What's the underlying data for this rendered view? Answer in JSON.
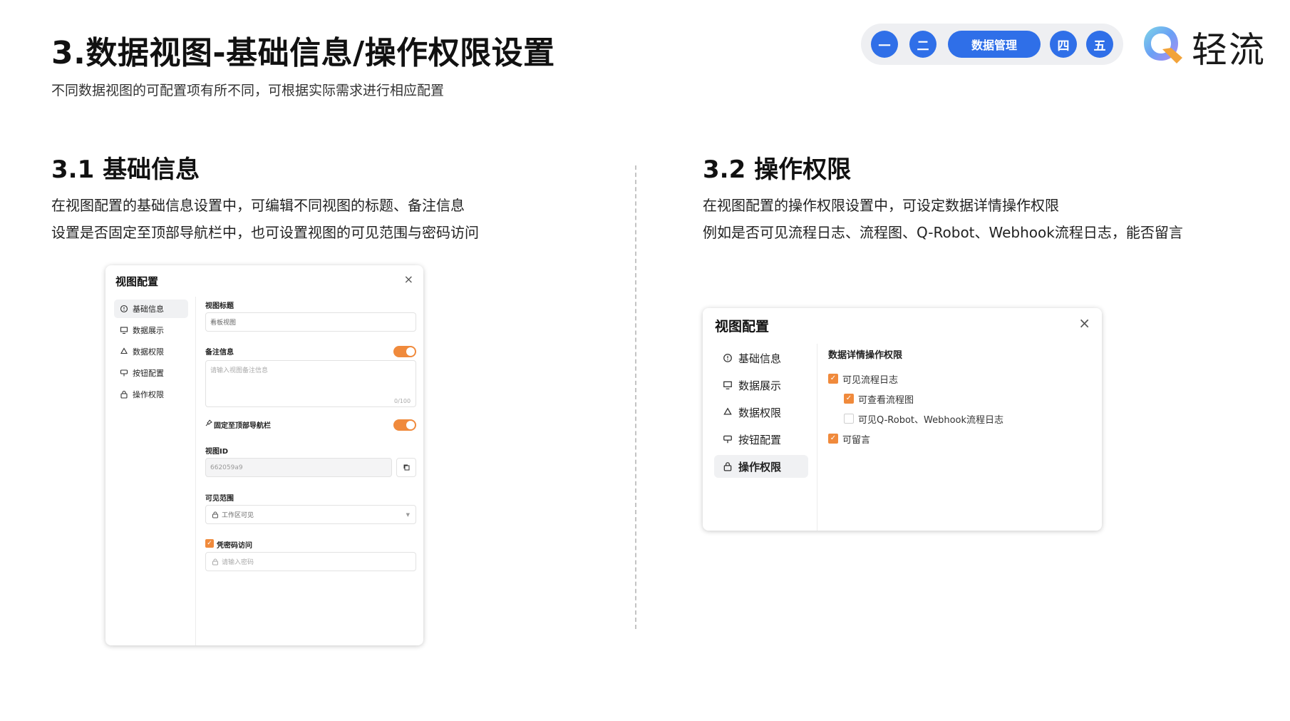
{
  "header": {
    "title": "3.数据视图-基础信息/操作权限设置",
    "subtitle": "不同数据视图的可配置项有所不同，可根据实际需求进行相应配置"
  },
  "nav": {
    "steps": [
      "一",
      "二",
      "数据管理",
      "四",
      "五"
    ],
    "active_index": 2,
    "accent": "#2f6fe8"
  },
  "brand": {
    "name": "轻流"
  },
  "section1": {
    "title": "3.1 基础信息",
    "desc_line1": "在视图配置的基础信息设置中，可编辑不同视图的标题、备注信息",
    "desc_line2": "设置是否固定至顶部导航栏中，也可设置视图的可见范围与密码访问"
  },
  "section2": {
    "title": "3.2 操作权限",
    "desc_line1": "在视图配置的操作权限设置中，可设定数据详情操作权限",
    "desc_line2": "例如是否可见流程日志、流程图、Q-Robot、Webhook流程日志，能否留言"
  },
  "dialog1": {
    "title": "视图配置",
    "close": "×",
    "menu": [
      {
        "label": "基础信息",
        "icon": "info-icon"
      },
      {
        "label": "数据展示",
        "icon": "display-icon"
      },
      {
        "label": "数据权限",
        "icon": "recycle-icon"
      },
      {
        "label": "按钮配置",
        "icon": "button-icon"
      },
      {
        "label": "操作权限",
        "icon": "lock-icon"
      }
    ],
    "active_menu": 0,
    "view_title_label": "视图标题",
    "view_title_value": "看板视图",
    "note_label": "备注信息",
    "note_on": true,
    "note_placeholder": "请输入视图备注信息",
    "note_counter": "0/100",
    "pin_label": "固定至顶部导航栏",
    "pin_on": true,
    "view_id_label": "视图ID",
    "view_id_value": "662059a9",
    "scope_label": "可见范围",
    "scope_value": "工作区可见",
    "password_label": "凭密码访问",
    "password_checked": true,
    "password_placeholder": "请输入密码",
    "toggle_color": "#f08a3c"
  },
  "dialog2": {
    "title": "视图配置",
    "close": "×",
    "menu": [
      {
        "label": "基础信息",
        "icon": "info-icon"
      },
      {
        "label": "数据展示",
        "icon": "display-icon"
      },
      {
        "label": "数据权限",
        "icon": "recycle-icon"
      },
      {
        "label": "按钮配置",
        "icon": "button-icon"
      },
      {
        "label": "操作权限",
        "icon": "lock-icon"
      }
    ],
    "active_menu": 4,
    "perm_heading": "数据详情操作权限",
    "perms": [
      {
        "label": "可见流程日志",
        "checked": true
      },
      {
        "label": "可查看流程图",
        "checked": true
      },
      {
        "label": "可见Q-Robot、Webhook流程日志",
        "checked": false
      },
      {
        "label": "可留言",
        "checked": true
      }
    ]
  }
}
